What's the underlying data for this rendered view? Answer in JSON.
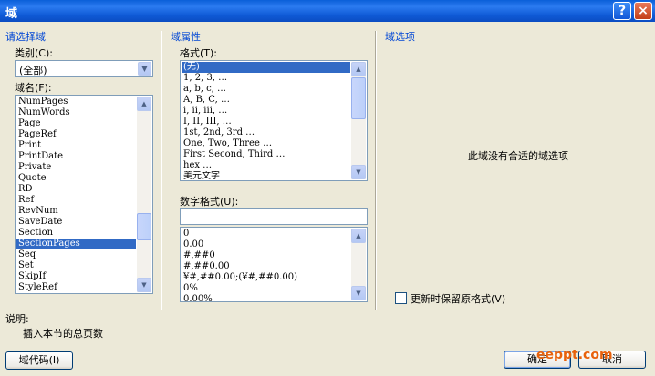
{
  "window": {
    "title": "域",
    "help_label": "?",
    "close_label": "×"
  },
  "select_field": {
    "heading": "请选择域",
    "category_label": "类别(C):",
    "category_value": "(全部)",
    "fieldname_label": "域名(F):",
    "field_names": [
      "NumPages",
      "NumWords",
      "Page",
      "PageRef",
      "Print",
      "PrintDate",
      "Private",
      "Quote",
      "RD",
      "Ref",
      "RevNum",
      "SaveDate",
      "Section",
      "SectionPages",
      "Seq",
      "Set",
      "SkipIf",
      "StyleRef"
    ],
    "selected_field": "SectionPages"
  },
  "field_properties": {
    "heading": "域属性",
    "format_label": "格式(T):",
    "formats": [
      "(无)",
      "1, 2, 3, …",
      "a, b, c, …",
      "A, B, C, …",
      "i, ii, iii, …",
      "I, II, III, …",
      "1st, 2nd, 3rd …",
      "One, Two, Three …",
      "First Second, Third …",
      "hex …",
      "美元文字"
    ],
    "selected_format": "(无)",
    "number_format_label": "数字格式(U):",
    "number_format_value": "",
    "number_formats": [
      "0",
      "0.00",
      "#,##0",
      "#,##0.00",
      "¥#,##0.00;(¥#,##0.00)",
      "0%",
      "0.00%"
    ]
  },
  "field_options": {
    "heading": "域选项",
    "empty_message": "此域没有合适的域选项",
    "preserve_label": "更新时保留原格式(V)"
  },
  "description": {
    "label": "说明:",
    "text": "插入本节的总页数"
  },
  "buttons": {
    "field_codes": "域代码(I)",
    "ok": "确定",
    "cancel": "取消"
  },
  "watermark": "eeppt.com",
  "colors": {
    "title_bar": "#0A5FD8",
    "selection": "#316AC5",
    "section_heading": "#0046D5",
    "dialog_bg": "#ECE9D8"
  }
}
